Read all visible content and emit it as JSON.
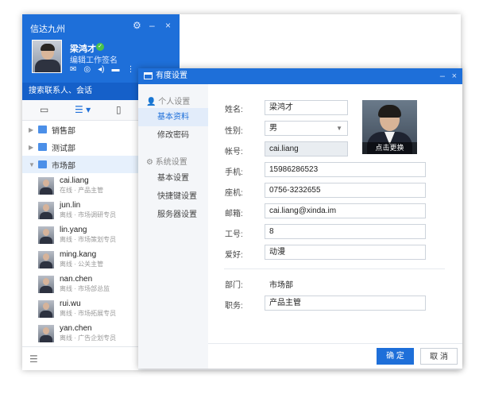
{
  "app": {
    "title": "信达九州",
    "controls": {
      "settings": "⚙",
      "minimize": "–",
      "close": "×"
    }
  },
  "user": {
    "name": "梁鸿才",
    "status_color": "#49c24a",
    "signature": "编辑工作签名",
    "toolbar_icons": [
      "mail-icon",
      "bell-icon",
      "sound-icon",
      "chat-icon",
      "more-icon"
    ]
  },
  "search": {
    "placeholder": "搜索联系人、会话"
  },
  "contact_tabs": [
    "chat-tab-icon",
    "org-tree-tab-icon",
    "group-tab-icon"
  ],
  "tree": {
    "groups": [
      {
        "label": "销售部",
        "expanded": false
      },
      {
        "label": "测试部",
        "expanded": false
      },
      {
        "label": "市场部",
        "expanded": true
      }
    ],
    "contacts": [
      {
        "name": "cai.liang",
        "status": "在线 · 产品主管"
      },
      {
        "name": "jun.lin",
        "status": "离线 · 市场调研专员"
      },
      {
        "name": "lin.yang",
        "status": "离线 · 市场策划专员"
      },
      {
        "name": "ming.kang",
        "status": "离线 · 公关主管"
      },
      {
        "name": "nan.chen",
        "status": "离线 · 市场部总监"
      },
      {
        "name": "rui.wu",
        "status": "离线 · 市场拓展专员"
      },
      {
        "name": "yan.chen",
        "status": "离线 · 广告企划专员"
      }
    ]
  },
  "dialog": {
    "title": "有度设置",
    "minimize": "–",
    "close": "×",
    "nav": {
      "personal_header": "个人设置",
      "personal_items": [
        "基本资料",
        "修改密码"
      ],
      "system_header": "系统设置",
      "system_items": [
        "基本设置",
        "快捷键设置",
        "服务器设置"
      ],
      "active": "基本资料"
    },
    "form": {
      "name_label": "姓名:",
      "name_value": "梁鸿才",
      "gender_label": "性别:",
      "gender_value": "男",
      "account_label": "帐号:",
      "account_value": "cai.liang",
      "phone_label": "手机:",
      "phone_value": "15986286523",
      "landline_label": "座机:",
      "landline_value": "0756-3232655",
      "email_label": "邮箱:",
      "email_value": "cai.liang@xinda.im",
      "employee_label": "工号:",
      "employee_value": "8",
      "hobby_label": "爱好:",
      "hobby_value": "动漫",
      "dept_label": "部门:",
      "dept_value": "市场部",
      "position_label": "职务:",
      "position_value": "产品主管"
    },
    "photo": {
      "change_label": "点击更换"
    },
    "buttons": {
      "ok": "确 定",
      "cancel": "取 消"
    }
  },
  "colors": {
    "brand": "#1e6fd9",
    "header_dark": "#1560c9"
  }
}
